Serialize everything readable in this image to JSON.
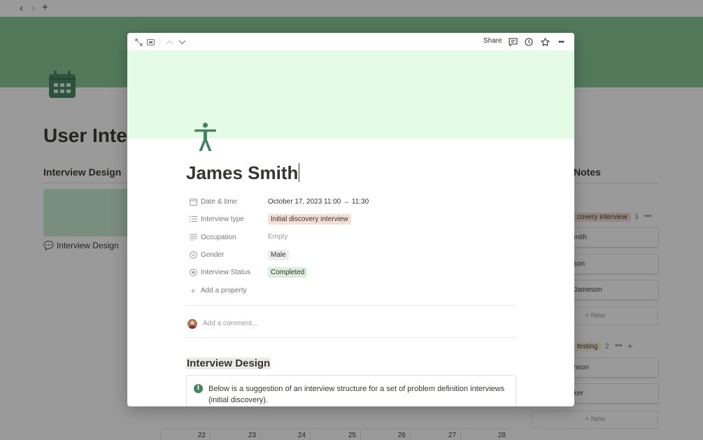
{
  "background": {
    "title": "User Inter",
    "left_heading": "Interview Design",
    "right_heading": "Notes",
    "card_link": "Interview Design",
    "group1": {
      "tag": "covery interview",
      "count": "3"
    },
    "group1_cards": [
      "mith",
      "son",
      "Jameson"
    ],
    "group2": {
      "tag": "testing",
      "count": "2"
    },
    "group2_cards": [
      "nson",
      "ker"
    ],
    "new_label": "+ New",
    "calendar_days": [
      "22",
      "23",
      "24",
      "25",
      "26",
      "27",
      "28"
    ]
  },
  "modal": {
    "share_label": "Share",
    "title": "James Smith",
    "properties": [
      {
        "label": "Date & time",
        "value": "October 17, 2023 11:00 → 11:30",
        "icon": "calendar-icon"
      },
      {
        "label": "Interview type",
        "value": "Initial discovery interview",
        "icon": "list-icon"
      },
      {
        "label": "Occupation",
        "value": "Empty",
        "icon": "text-lines-icon"
      },
      {
        "label": "Gender",
        "value": "Male",
        "icon": "select-icon"
      },
      {
        "label": "Interview Status",
        "value": "Completed",
        "icon": "status-icon"
      }
    ],
    "add_property_label": "Add a property",
    "comment_placeholder": "Add a comment...",
    "section_heading": "Interview Design",
    "callout_text": "Below is a suggestion of an interview structure for a set of problem definition interviews (initial discovery).",
    "colors": {
      "cover": "#e4fce6",
      "icon": "#448361",
      "interview_type_pill": "#f4dfd6",
      "gender_pill": "#ededeb",
      "status_pill": "#dbeddb"
    }
  }
}
